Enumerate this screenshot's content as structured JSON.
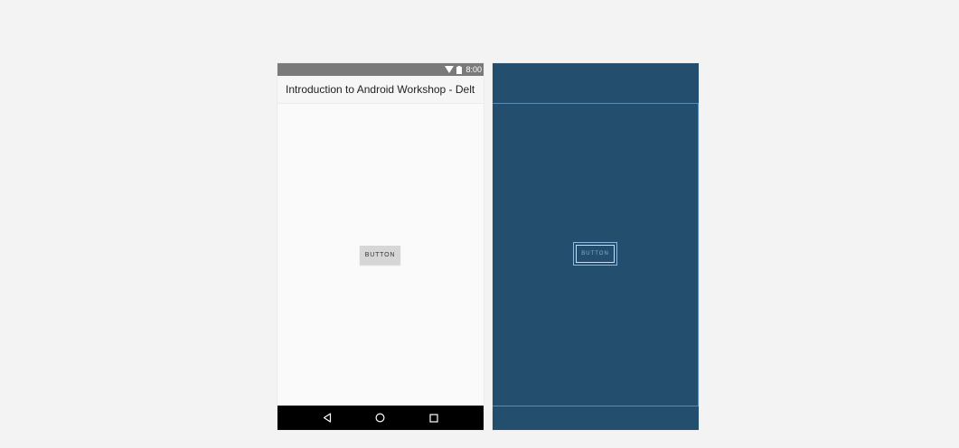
{
  "design_preview": {
    "status_bar": {
      "time": "8:00",
      "icons": [
        "wifi-icon",
        "battery-icon"
      ],
      "background": "#7a7a7a"
    },
    "app_bar": {
      "title": "Introduction to Android Workshop - Delt..."
    },
    "button": {
      "label": "BUTTON"
    },
    "nav_bar": {
      "items": [
        "back-icon",
        "home-icon",
        "recents-icon"
      ],
      "background": "#000000"
    }
  },
  "blueprint_preview": {
    "button": {
      "label": "BUTTON"
    },
    "background": "#234e6e",
    "outline_color": "#5a8ab8"
  },
  "canvas_background": "#f3f3f3"
}
